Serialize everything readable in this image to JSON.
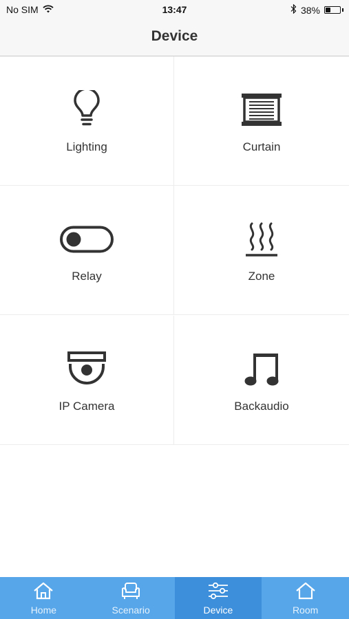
{
  "status_bar": {
    "carrier": "No SIM",
    "time": "13:47",
    "battery_percent": "38%",
    "battery_level": 0.38,
    "icons": [
      "wifi-icon",
      "bluetooth-icon",
      "battery-icon"
    ]
  },
  "nav": {
    "title": "Device"
  },
  "devices": [
    {
      "label": "Lighting",
      "icon": "lightbulb-icon"
    },
    {
      "label": "Curtain",
      "icon": "curtain-icon"
    },
    {
      "label": "Relay",
      "icon": "toggle-icon"
    },
    {
      "label": "Zone",
      "icon": "heating-icon"
    },
    {
      "label": "IP Camera",
      "icon": "camera-icon"
    },
    {
      "label": "Backaudio",
      "icon": "music-note-icon"
    }
  ],
  "tabs": [
    {
      "label": "Home",
      "icon": "home-icon",
      "active": false
    },
    {
      "label": "Scenario",
      "icon": "armchair-icon",
      "active": false
    },
    {
      "label": "Device",
      "icon": "sliders-icon",
      "active": true
    },
    {
      "label": "Room",
      "icon": "room-icon",
      "active": false
    }
  ],
  "colors": {
    "tab_bar": "#56a6e9",
    "tab_active": "#3d8fdb",
    "icon": "#333333",
    "nav_background": "#f7f7f7"
  }
}
